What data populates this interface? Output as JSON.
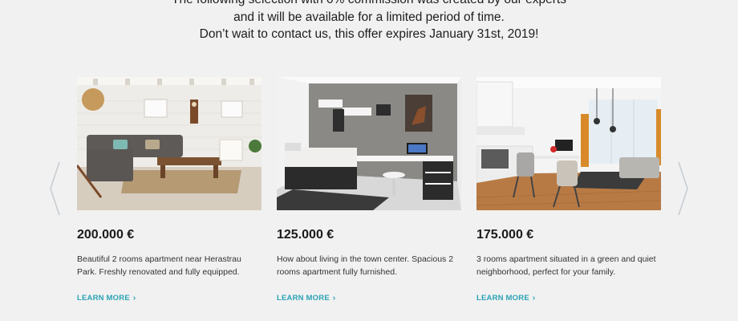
{
  "intro": {
    "line1": "The following selection with 0% commission was created by our experts",
    "line2": "and it will be available for a limited period of time.",
    "line3": "Don’t wait to contact us, this offer expires January 31st, 2019!"
  },
  "navigation": {
    "prev_icon": "chevron-left-icon",
    "next_icon": "chevron-right-icon"
  },
  "listings": [
    {
      "price": "200.000 €",
      "description": "Beautiful 2 rooms apartment near Herastrau Park. Freshly renovated and fully equipped.",
      "link": "LEARN MORE",
      "chevron": "›"
    },
    {
      "price": "125.000 €",
      "description": "How about living in the town center. Spacious 2 rooms apartment fully furnished.",
      "link": "LEARN MORE",
      "chevron": "›"
    },
    {
      "price": "175.000 €",
      "description": "3 rooms apartment situated in a green and quiet neighborhood, perfect for your family.",
      "link": "LEARN MORE",
      "chevron": "›"
    }
  ],
  "colors": {
    "background": "#f1f1f1",
    "accent": "#2aa3b5",
    "arrow": "#c7cdd3"
  }
}
